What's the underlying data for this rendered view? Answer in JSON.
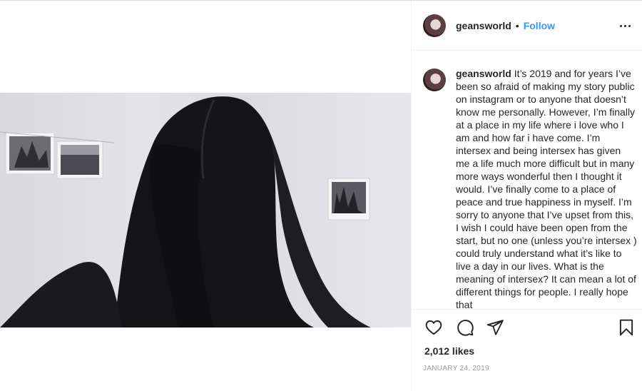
{
  "post": {
    "username": "geansworld",
    "follow_label": "Follow",
    "dot": "•",
    "caption": "It’s 2019 and for years I’ve been so afraid of making my story public on instagram or to anyone that doesn’t know me personally. However, I’m finally at a place in my life where i love who I am and how far i have come. I’m intersex and being intersex has given me a life much more difficult but in many more ways wonderful then I thought it would. I’ve finally come to a place of peace and true happiness in myself. I’m sorry to anyone that I’ve upset from this, I wish I could have been open from the start, but no one (unless you’re intersex ) could truly understand what it’s like to live a day in our lives. What is the meaning of intersex? It can mean a lot of different things for people. I really hope that",
    "likes": "2,012 likes",
    "date": "JANUARY 24, 2019"
  },
  "icons": {
    "more": "more-options-icon",
    "like": "heart-icon",
    "comment": "comment-icon",
    "share": "share-icon",
    "save": "bookmark-icon"
  },
  "colors": {
    "accent": "#3897f0",
    "text": "#262626",
    "muted": "#999999",
    "border": "#efefef"
  }
}
